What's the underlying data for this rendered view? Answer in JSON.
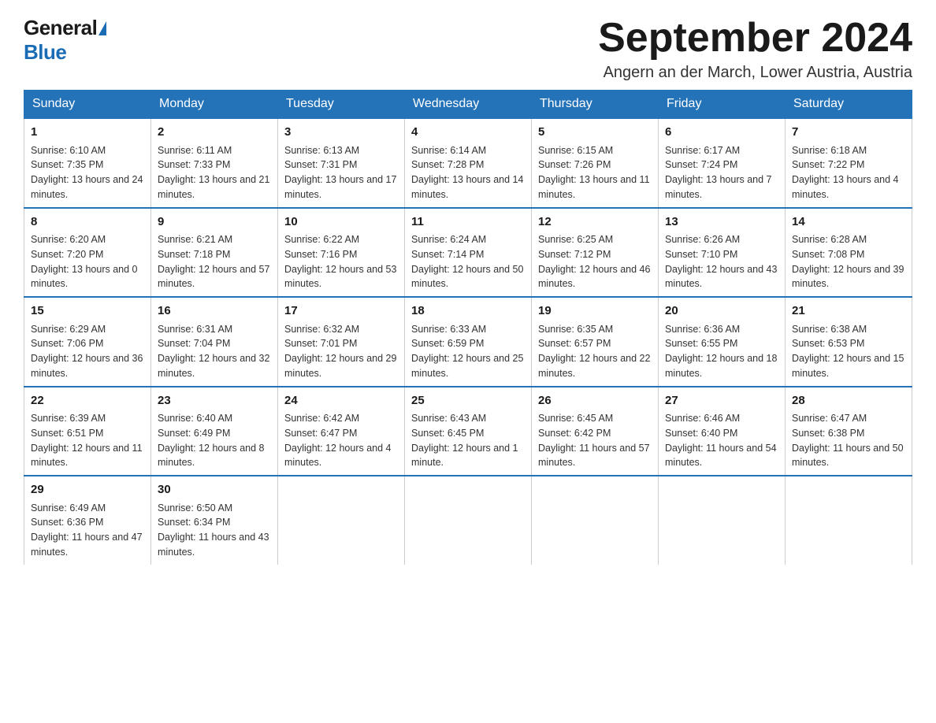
{
  "logo": {
    "general": "General",
    "blue": "Blue"
  },
  "title": "September 2024",
  "location": "Angern an der March, Lower Austria, Austria",
  "days_of_week": [
    "Sunday",
    "Monday",
    "Tuesday",
    "Wednesday",
    "Thursday",
    "Friday",
    "Saturday"
  ],
  "weeks": [
    [
      {
        "day": "1",
        "sunrise": "Sunrise: 6:10 AM",
        "sunset": "Sunset: 7:35 PM",
        "daylight": "Daylight: 13 hours and 24 minutes."
      },
      {
        "day": "2",
        "sunrise": "Sunrise: 6:11 AM",
        "sunset": "Sunset: 7:33 PM",
        "daylight": "Daylight: 13 hours and 21 minutes."
      },
      {
        "day": "3",
        "sunrise": "Sunrise: 6:13 AM",
        "sunset": "Sunset: 7:31 PM",
        "daylight": "Daylight: 13 hours and 17 minutes."
      },
      {
        "day": "4",
        "sunrise": "Sunrise: 6:14 AM",
        "sunset": "Sunset: 7:28 PM",
        "daylight": "Daylight: 13 hours and 14 minutes."
      },
      {
        "day": "5",
        "sunrise": "Sunrise: 6:15 AM",
        "sunset": "Sunset: 7:26 PM",
        "daylight": "Daylight: 13 hours and 11 minutes."
      },
      {
        "day": "6",
        "sunrise": "Sunrise: 6:17 AM",
        "sunset": "Sunset: 7:24 PM",
        "daylight": "Daylight: 13 hours and 7 minutes."
      },
      {
        "day": "7",
        "sunrise": "Sunrise: 6:18 AM",
        "sunset": "Sunset: 7:22 PM",
        "daylight": "Daylight: 13 hours and 4 minutes."
      }
    ],
    [
      {
        "day": "8",
        "sunrise": "Sunrise: 6:20 AM",
        "sunset": "Sunset: 7:20 PM",
        "daylight": "Daylight: 13 hours and 0 minutes."
      },
      {
        "day": "9",
        "sunrise": "Sunrise: 6:21 AM",
        "sunset": "Sunset: 7:18 PM",
        "daylight": "Daylight: 12 hours and 57 minutes."
      },
      {
        "day": "10",
        "sunrise": "Sunrise: 6:22 AM",
        "sunset": "Sunset: 7:16 PM",
        "daylight": "Daylight: 12 hours and 53 minutes."
      },
      {
        "day": "11",
        "sunrise": "Sunrise: 6:24 AM",
        "sunset": "Sunset: 7:14 PM",
        "daylight": "Daylight: 12 hours and 50 minutes."
      },
      {
        "day": "12",
        "sunrise": "Sunrise: 6:25 AM",
        "sunset": "Sunset: 7:12 PM",
        "daylight": "Daylight: 12 hours and 46 minutes."
      },
      {
        "day": "13",
        "sunrise": "Sunrise: 6:26 AM",
        "sunset": "Sunset: 7:10 PM",
        "daylight": "Daylight: 12 hours and 43 minutes."
      },
      {
        "day": "14",
        "sunrise": "Sunrise: 6:28 AM",
        "sunset": "Sunset: 7:08 PM",
        "daylight": "Daylight: 12 hours and 39 minutes."
      }
    ],
    [
      {
        "day": "15",
        "sunrise": "Sunrise: 6:29 AM",
        "sunset": "Sunset: 7:06 PM",
        "daylight": "Daylight: 12 hours and 36 minutes."
      },
      {
        "day": "16",
        "sunrise": "Sunrise: 6:31 AM",
        "sunset": "Sunset: 7:04 PM",
        "daylight": "Daylight: 12 hours and 32 minutes."
      },
      {
        "day": "17",
        "sunrise": "Sunrise: 6:32 AM",
        "sunset": "Sunset: 7:01 PM",
        "daylight": "Daylight: 12 hours and 29 minutes."
      },
      {
        "day": "18",
        "sunrise": "Sunrise: 6:33 AM",
        "sunset": "Sunset: 6:59 PM",
        "daylight": "Daylight: 12 hours and 25 minutes."
      },
      {
        "day": "19",
        "sunrise": "Sunrise: 6:35 AM",
        "sunset": "Sunset: 6:57 PM",
        "daylight": "Daylight: 12 hours and 22 minutes."
      },
      {
        "day": "20",
        "sunrise": "Sunrise: 6:36 AM",
        "sunset": "Sunset: 6:55 PM",
        "daylight": "Daylight: 12 hours and 18 minutes."
      },
      {
        "day": "21",
        "sunrise": "Sunrise: 6:38 AM",
        "sunset": "Sunset: 6:53 PM",
        "daylight": "Daylight: 12 hours and 15 minutes."
      }
    ],
    [
      {
        "day": "22",
        "sunrise": "Sunrise: 6:39 AM",
        "sunset": "Sunset: 6:51 PM",
        "daylight": "Daylight: 12 hours and 11 minutes."
      },
      {
        "day": "23",
        "sunrise": "Sunrise: 6:40 AM",
        "sunset": "Sunset: 6:49 PM",
        "daylight": "Daylight: 12 hours and 8 minutes."
      },
      {
        "day": "24",
        "sunrise": "Sunrise: 6:42 AM",
        "sunset": "Sunset: 6:47 PM",
        "daylight": "Daylight: 12 hours and 4 minutes."
      },
      {
        "day": "25",
        "sunrise": "Sunrise: 6:43 AM",
        "sunset": "Sunset: 6:45 PM",
        "daylight": "Daylight: 12 hours and 1 minute."
      },
      {
        "day": "26",
        "sunrise": "Sunrise: 6:45 AM",
        "sunset": "Sunset: 6:42 PM",
        "daylight": "Daylight: 11 hours and 57 minutes."
      },
      {
        "day": "27",
        "sunrise": "Sunrise: 6:46 AM",
        "sunset": "Sunset: 6:40 PM",
        "daylight": "Daylight: 11 hours and 54 minutes."
      },
      {
        "day": "28",
        "sunrise": "Sunrise: 6:47 AM",
        "sunset": "Sunset: 6:38 PM",
        "daylight": "Daylight: 11 hours and 50 minutes."
      }
    ],
    [
      {
        "day": "29",
        "sunrise": "Sunrise: 6:49 AM",
        "sunset": "Sunset: 6:36 PM",
        "daylight": "Daylight: 11 hours and 47 minutes."
      },
      {
        "day": "30",
        "sunrise": "Sunrise: 6:50 AM",
        "sunset": "Sunset: 6:34 PM",
        "daylight": "Daylight: 11 hours and 43 minutes."
      },
      null,
      null,
      null,
      null,
      null
    ]
  ]
}
